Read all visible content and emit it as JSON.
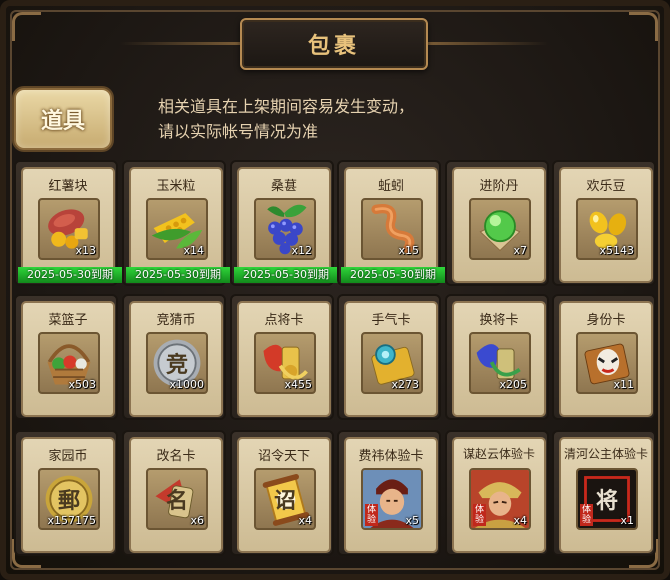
{
  "title": "包裹",
  "tab": {
    "label": "道具"
  },
  "notice": {
    "line1": "相关道具在上架期间容易发生变动，",
    "line2": "请以实际帐号情况为准"
  },
  "items": [
    {
      "name": "红薯块",
      "count": "x13",
      "icon": "sweet-potato-icon",
      "expire": "2025-05-30到期"
    },
    {
      "name": "玉米粒",
      "count": "x14",
      "icon": "corn-icon",
      "expire": "2025-05-30到期"
    },
    {
      "name": "桑葚",
      "count": "x12",
      "icon": "mulberry-icon",
      "expire": "2025-05-30到期"
    },
    {
      "name": "蚯蚓",
      "count": "x15",
      "icon": "earthworm-icon",
      "expire": "2025-05-30到期"
    },
    {
      "name": "进阶丹",
      "count": "x7",
      "icon": "jade-pill-icon"
    },
    {
      "name": "欢乐豆",
      "count": "x5143",
      "icon": "gold-beans-icon"
    },
    {
      "name": "菜篮子",
      "count": "x503",
      "icon": "vegetable-basket-icon"
    },
    {
      "name": "竞猜币",
      "count": "x1000",
      "icon": "silver-coin-icon",
      "glyph": "竞"
    },
    {
      "name": "点将卡",
      "count": "x455",
      "icon": "general-card-icon"
    },
    {
      "name": "手气卡",
      "count": "x273",
      "icon": "luck-card-icon"
    },
    {
      "name": "换将卡",
      "count": "x205",
      "icon": "swap-card-icon"
    },
    {
      "name": "身份卡",
      "count": "x11",
      "icon": "identity-card-icon"
    },
    {
      "name": "家园币",
      "count": "x157175",
      "icon": "home-coin-icon",
      "glyph": "郵"
    },
    {
      "name": "改名卡",
      "count": "x6",
      "icon": "rename-card-icon",
      "glyph": "名"
    },
    {
      "name": "诏令天下",
      "count": "x4",
      "icon": "edict-scroll-icon",
      "glyph": "诏"
    },
    {
      "name": "费祎体验卡",
      "count": "x5",
      "icon": "portrait-feiyi-icon",
      "badge": "体验"
    },
    {
      "name": "谋赵云体验卡",
      "count": "x4",
      "icon": "portrait-zhaoyun-icon",
      "badge": "体验"
    },
    {
      "name": "清河公主体验卡",
      "count": "x1",
      "icon": "portrait-qinghe-icon",
      "badge": "体验",
      "glyph": "将"
    }
  ]
}
